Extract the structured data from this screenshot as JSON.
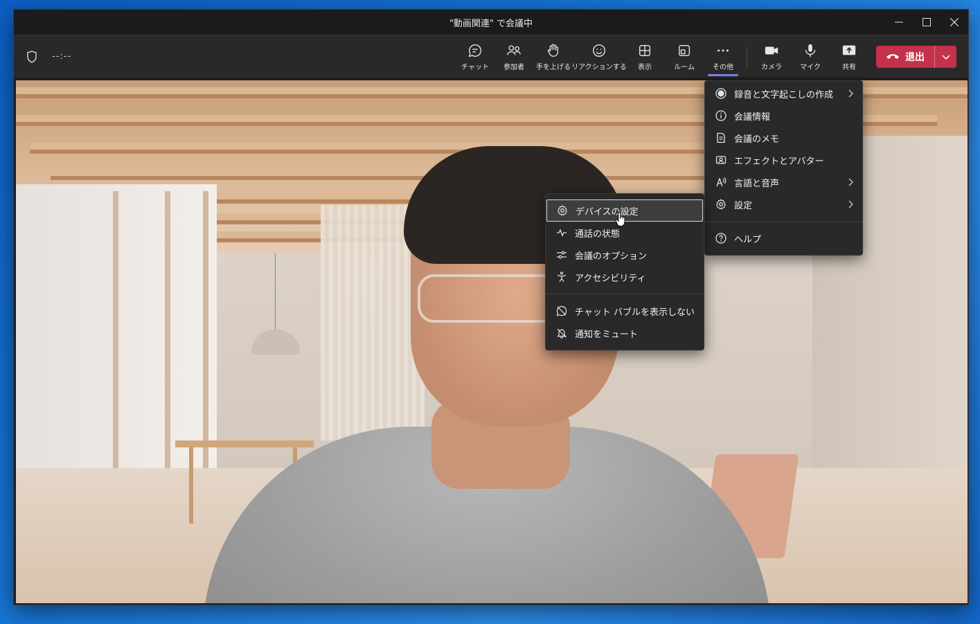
{
  "window": {
    "title": "\"動画関連\" で会議中"
  },
  "toolbar": {
    "timer": "--:--",
    "buttons": [
      {
        "label": "チャット",
        "icon": "chat-icon"
      },
      {
        "label": "参加者",
        "icon": "people-icon"
      },
      {
        "label": "手を上げる",
        "icon": "raise-hand-icon"
      },
      {
        "label": "リアクションする",
        "icon": "reaction-icon"
      },
      {
        "label": "表示",
        "icon": "view-grid-icon"
      },
      {
        "label": "ルーム",
        "icon": "room-icon"
      },
      {
        "label": "その他",
        "icon": "more-icon"
      }
    ],
    "media": [
      {
        "label": "カメラ",
        "icon": "camera-icon"
      },
      {
        "label": "マイク",
        "icon": "mic-icon"
      },
      {
        "label": "共有",
        "icon": "share-icon"
      }
    ],
    "leave_label": "退出",
    "leave_color": "#c4314b",
    "accent_color": "#7f85f5"
  },
  "more_menu": {
    "items": [
      {
        "label": "録音と文字起こしの作成",
        "icon": "record-icon",
        "submenu": true
      },
      {
        "label": "会議情報",
        "icon": "info-icon",
        "submenu": false
      },
      {
        "label": "会議のメモ",
        "icon": "notes-icon",
        "submenu": false
      },
      {
        "label": "エフェクトとアバター",
        "icon": "effects-icon",
        "submenu": false
      },
      {
        "label": "言語と音声",
        "icon": "language-icon",
        "submenu": true
      },
      {
        "label": "設定",
        "icon": "settings-icon",
        "submenu": true
      },
      {
        "label": "ヘルプ",
        "icon": "help-icon",
        "submenu": false
      }
    ]
  },
  "settings_submenu": {
    "items": [
      {
        "label": "デバイスの設定",
        "icon": "gear-icon",
        "highlighted": true
      },
      {
        "label": "通話の状態",
        "icon": "pulse-icon"
      },
      {
        "label": "会議のオプション",
        "icon": "options-icon"
      },
      {
        "label": "アクセシビリティ",
        "icon": "accessibility-icon"
      },
      {
        "label": "チャット バブルを表示しない",
        "icon": "chat-bubble-off-icon"
      },
      {
        "label": "通知をミュート",
        "icon": "bell-off-icon"
      }
    ]
  }
}
